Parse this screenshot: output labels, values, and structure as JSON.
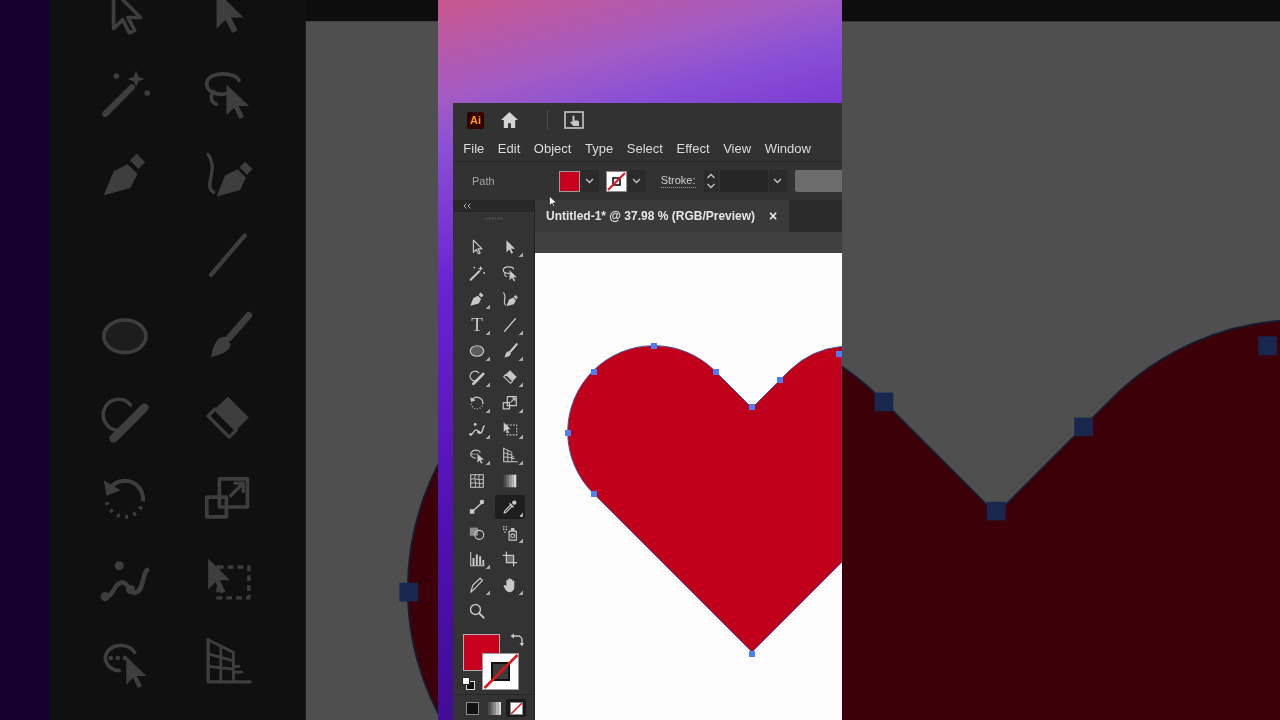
{
  "app_bar": {
    "logo": "Ai"
  },
  "menu": [
    "File",
    "Edit",
    "Object",
    "Type",
    "Select",
    "Effect",
    "View",
    "Window"
  ],
  "control_bar": {
    "selection": "Path",
    "fill_swatch": {
      "color": "#c8001e"
    },
    "stroke_swatch": {
      "none": true
    },
    "stroke_label": "Stroke:"
  },
  "toolbar": {
    "tools": [
      {
        "selected": false
      },
      {
        "selected": false
      },
      {
        "selected": false
      },
      {
        "selected": false
      },
      {
        "selected": false
      },
      {
        "selected": false
      },
      {
        "glyph": "T",
        "selected": false
      },
      {
        "selected": false
      },
      {
        "selected": false
      },
      {
        "selected": false
      },
      {
        "selected": false
      },
      {
        "selected": false
      },
      {
        "selected": false
      },
      {
        "selected": false
      },
      {
        "selected": false
      },
      {
        "selected": false
      },
      {
        "selected": false
      },
      {
        "selected": false
      },
      {
        "selected": false
      },
      {
        "selected": false
      },
      {
        "selected": false
      },
      {
        "selected": true
      },
      {
        "selected": false
      },
      {
        "selected": false
      },
      {
        "selected": false
      },
      {
        "selected": false
      },
      {
        "selected": false
      },
      {
        "selected": false
      },
      {
        "selected": false
      }
    ],
    "fill": {
      "color": "#c8001e"
    },
    "stroke": {
      "none": true
    },
    "color_modes": [
      {
        "selected": false
      },
      {
        "selected": false
      },
      {
        "selected": true
      }
    ]
  },
  "document_tab": {
    "title": "Untitled-1* @ 37.98 % (RGB/Preview)",
    "close": "×"
  }
}
